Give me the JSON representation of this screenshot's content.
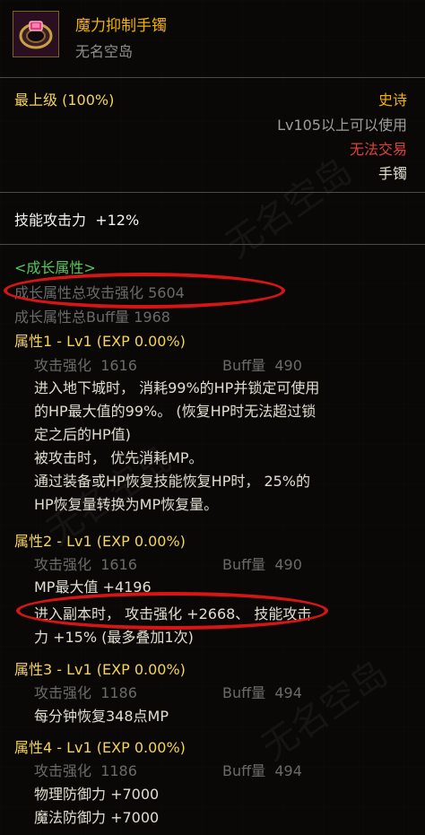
{
  "item": {
    "name": "魔力抑制手镯",
    "source": "无名空岛",
    "grade": "最上级 (100%)",
    "rarity": "史诗",
    "level_req": "Lv105以上可以使用",
    "trade": "无法交易",
    "type": "手镯"
  },
  "skill": {
    "label": "技能攻击力",
    "value": "+12%"
  },
  "growth": {
    "header": "<成长属性>",
    "total_attack": "成长属性总攻击强化 5604",
    "total_buff": "成长属性总Buff量 1968",
    "attributes": [
      {
        "title": "属性1 - Lv1 (EXP 0.00%)",
        "stat_attack_label": "攻击强化",
        "stat_attack": "1616",
        "stat_buff_label": "Buff量",
        "stat_buff": "490",
        "lines": [
          "进入地下城时， 消耗99%的HP并锁定可使用",
          "的HP最大值的99%。 (恢复HP时无法超过锁",
          "定之后的HP值)",
          "被攻击时， 优先消耗MP。",
          "通过装备或HP恢复技能恢复HP时， 25%的",
          "HP恢复量转换为MP恢复量。"
        ]
      },
      {
        "title": "属性2 - Lv1 (EXP 0.00%)",
        "stat_attack_label": "攻击强化",
        "stat_attack": "1616",
        "stat_buff_label": "Buff量",
        "stat_buff": "490",
        "lines": [
          "MP最大值 +4196",
          "进入副本时， 攻击强化 +2668、 技能攻击",
          "力 +15% (最多叠加1次)"
        ]
      },
      {
        "title": "属性3 - Lv1 (EXP 0.00%)",
        "stat_attack_label": "攻击强化",
        "stat_attack": "1186",
        "stat_buff_label": "Buff量",
        "stat_buff": "494",
        "lines": [
          "每分钟恢复348点MP"
        ]
      },
      {
        "title": "属性4 - Lv1 (EXP 0.00%)",
        "stat_attack_label": "攻击强化",
        "stat_attack": "1186",
        "stat_buff_label": "Buff量",
        "stat_buff": "494",
        "lines": [
          "物理防御力 +7000",
          "魔法防御力 +7000"
        ]
      }
    ]
  },
  "watermark": "无名空岛",
  "icon": "bracelet-icon",
  "colors": {
    "name": "#f0b100",
    "grade": "#f4d25c",
    "trade": "#e0403a",
    "growth_header": "#56c85a",
    "highlight_circle": "#d81515"
  }
}
